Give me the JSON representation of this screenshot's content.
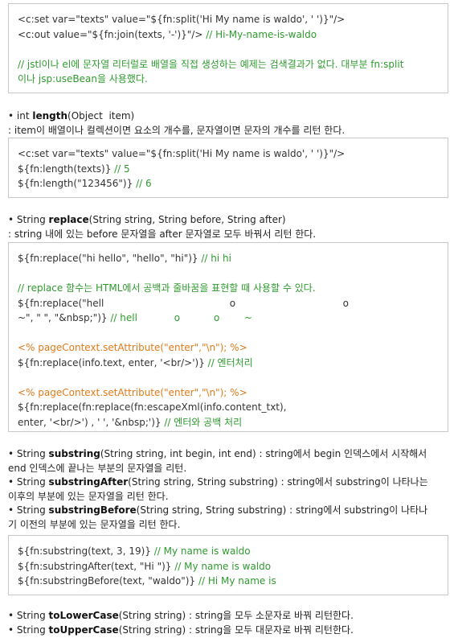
{
  "box1": [
    [
      "<c:set var=\"texts\" value=\"${fn:split('Hi My name is waldo', ' ')}\"/>",
      ""
    ],
    [
      "<c:out value=\"${fn:join(texts, '-')}\"/> ",
      "// Hi-My-name-is-waldo"
    ],
    [
      "",
      ""
    ],
    [
      "",
      "// jstl이나 el에 문자열 리터럴로 배열을 직접 생성하는 예제는 검색결과가 없다. 대부분 fn:split"
    ],
    [
      "",
      "이나 jsp:useBean을 사용했다."
    ]
  ],
  "length": {
    "bullet": "• ",
    "pre": "int ",
    "name": "length",
    "sig": "(Object  item)",
    "desc": ": item이 배열이나 컬렉션이면 요소의 개수를, 문자열이면 문자의 개수를 리턴 한다."
  },
  "box2": [
    [
      "<c:set var=\"texts\" value=\"${fn:split('Hi My name is waldo', ' ')}\"/>",
      ""
    ],
    [
      "${fn:length(texts)} ",
      "// 5"
    ],
    [
      "${fn:length(\"123456\")} ",
      "// 6"
    ]
  ],
  "replace": {
    "bullet": "• ",
    "pre": "String ",
    "name": "replace",
    "sig": "(String string, String before, String after)",
    "desc": ": string 내에 있는 before 문자열을 after 문자열로 모두 바꿔서 리턴 한다."
  },
  "box3": [
    [
      "${fn:replace(\"hi hello\", \"hello\", \"hi\")} ",
      "// hi hi",
      ""
    ],
    [
      "",
      "",
      ""
    ],
    [
      "",
      "// replace 함수는 HTML에서 공백과 줄바꿈을 표현할 때 사용할 수 있다.",
      ""
    ],
    [
      "${fn:replace(\"hell                                         o                                   o",
      "",
      ""
    ],
    [
      "~\", \" \", \"&nbsp;\")} ",
      "// hell            o           o        ~",
      ""
    ],
    [
      "",
      "",
      ""
    ],
    [
      "",
      "",
      "<% pageContext.setAttribute(\"enter\",\"\\n\"); %>"
    ],
    [
      "${fn:replace(info.text, enter, '<br/>')} ",
      "// 엔터처리",
      ""
    ],
    [
      "",
      "",
      ""
    ],
    [
      "",
      "",
      "<% pageContext.setAttribute(\"enter\",\"\\n\"); %>"
    ],
    [
      "${fn:replace(fn:replace(fn:escapeXml(info.content_txt),",
      "",
      ""
    ],
    [
      "enter, '<br/>') , ' ', '&nbsp;')} ",
      "// 엔터와 공백 처리",
      ""
    ]
  ],
  "substring": {
    "items": [
      {
        "bullet": "• ",
        "pre": "String ",
        "name": "substring",
        "sig1": "(String string, int begin, int end) : string에서 begin 인덱스에서 시작해서",
        "sig2": "end 인덱스에 끝나는 부분의 문자열을 리턴."
      },
      {
        "bullet": "• ",
        "pre": "String ",
        "name": "substringAfter",
        "sig1": "(String string, String substring) : string에서 substring이 나타나는",
        "sig2": "이후의 부분에 있는 문자열을 리턴 한다."
      },
      {
        "bullet": "• ",
        "pre": "String ",
        "name": "substringBefore",
        "sig1": "(String string, String substring) : string에서 substring이 나타나",
        "sig2": "기 이전의 부분에 있는 문자열을 리턴 한다."
      }
    ]
  },
  "box4": [
    [
      "${fn:substring(text, 3, 19)} ",
      "// My name is waldo"
    ],
    [
      "${fn:substringAfter(text, \"Hi \")} ",
      "// My name is waldo"
    ],
    [
      "${fn:substringBefore(text, \"waldo\")} ",
      "// Hi My name is"
    ]
  ],
  "case": [
    {
      "bullet": "• ",
      "pre": "String ",
      "name": "toLowerCase",
      "sig": "(String string) : string을 모두 소문자로 바꿔 리턴한다."
    },
    {
      "bullet": "• ",
      "pre": "String ",
      "name": "toUpperCase",
      "sig": "(String string) : string을 모두 대문자로 바꿔 리턴한다."
    }
  ],
  "colors": {
    "comment": "#2e9b2e",
    "scriptlet": "#e07a1a",
    "border": "#c8c8c8"
  }
}
